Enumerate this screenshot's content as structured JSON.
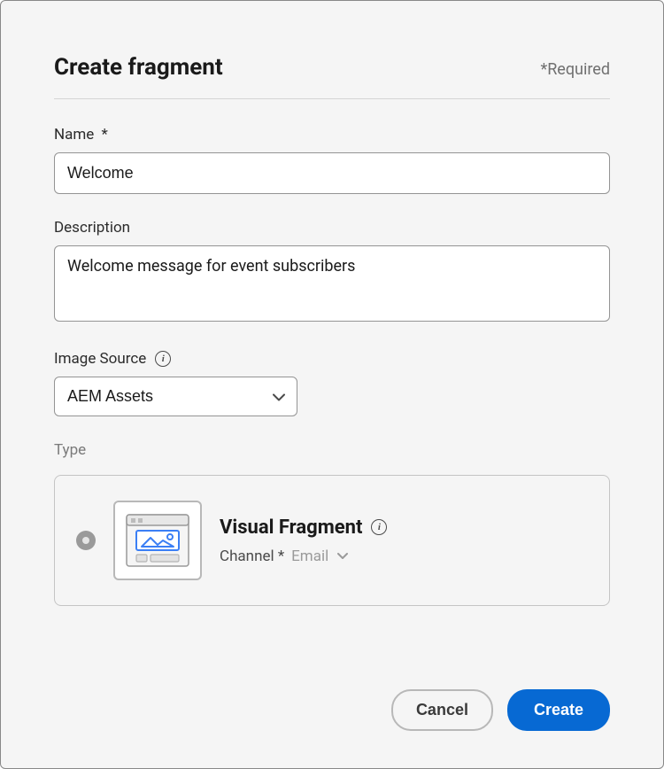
{
  "dialog": {
    "title": "Create fragment",
    "required_hint": "*Required"
  },
  "fields": {
    "name": {
      "label": "Name",
      "required_mark": "*",
      "value": "Welcome"
    },
    "description": {
      "label": "Description",
      "value": "Welcome message for event subscribers"
    },
    "image_source": {
      "label": "Image Source",
      "selected": "AEM Assets"
    },
    "type": {
      "label": "Type",
      "option_title": "Visual Fragment",
      "channel_label": "Channel *",
      "channel_value": "Email"
    }
  },
  "buttons": {
    "cancel": "Cancel",
    "create": "Create"
  }
}
